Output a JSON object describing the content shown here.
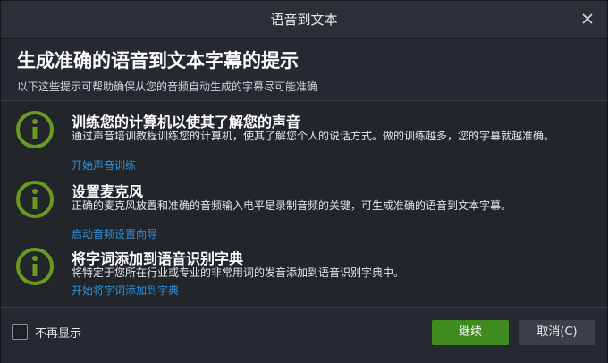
{
  "dialog": {
    "title": "语音到文本"
  },
  "header": {
    "heading": "生成准确的语音到文本字幕的提示",
    "subheading": "以下这些提示可帮助确保从您的音频自动生成的字幕尽可能准确"
  },
  "tips": [
    {
      "icon": "info-icon",
      "title": "训练您的计算机以使其了解您的声音",
      "description": "通过声音培训教程训练您的计算机，使其了解您个人的说话方式。做的训练越多，您的字幕就越准确。",
      "link": "开始声音训练"
    },
    {
      "icon": "info-icon",
      "title": "设置麦克风",
      "description": "正确的麦克风放置和准确的音频输入电平是录制音频的关键，可生成准确的语音到文本字幕。",
      "link": "启动音频设置向导"
    },
    {
      "icon": "info-icon",
      "title": "将字词添加到语音识别字典",
      "description": "将特定于您所在行业或专业的非常用词的发音添加到语音识别字典中。",
      "link": "开始将字词添加到字典"
    }
  ],
  "footer": {
    "dont_show_label": "不再显示",
    "continue_label": "继续",
    "cancel_label": "取消(C)"
  },
  "colors": {
    "accent_green": "#3f8b1e",
    "icon_green": "#6a9b1f",
    "link_blue": "#2f8fd6"
  }
}
